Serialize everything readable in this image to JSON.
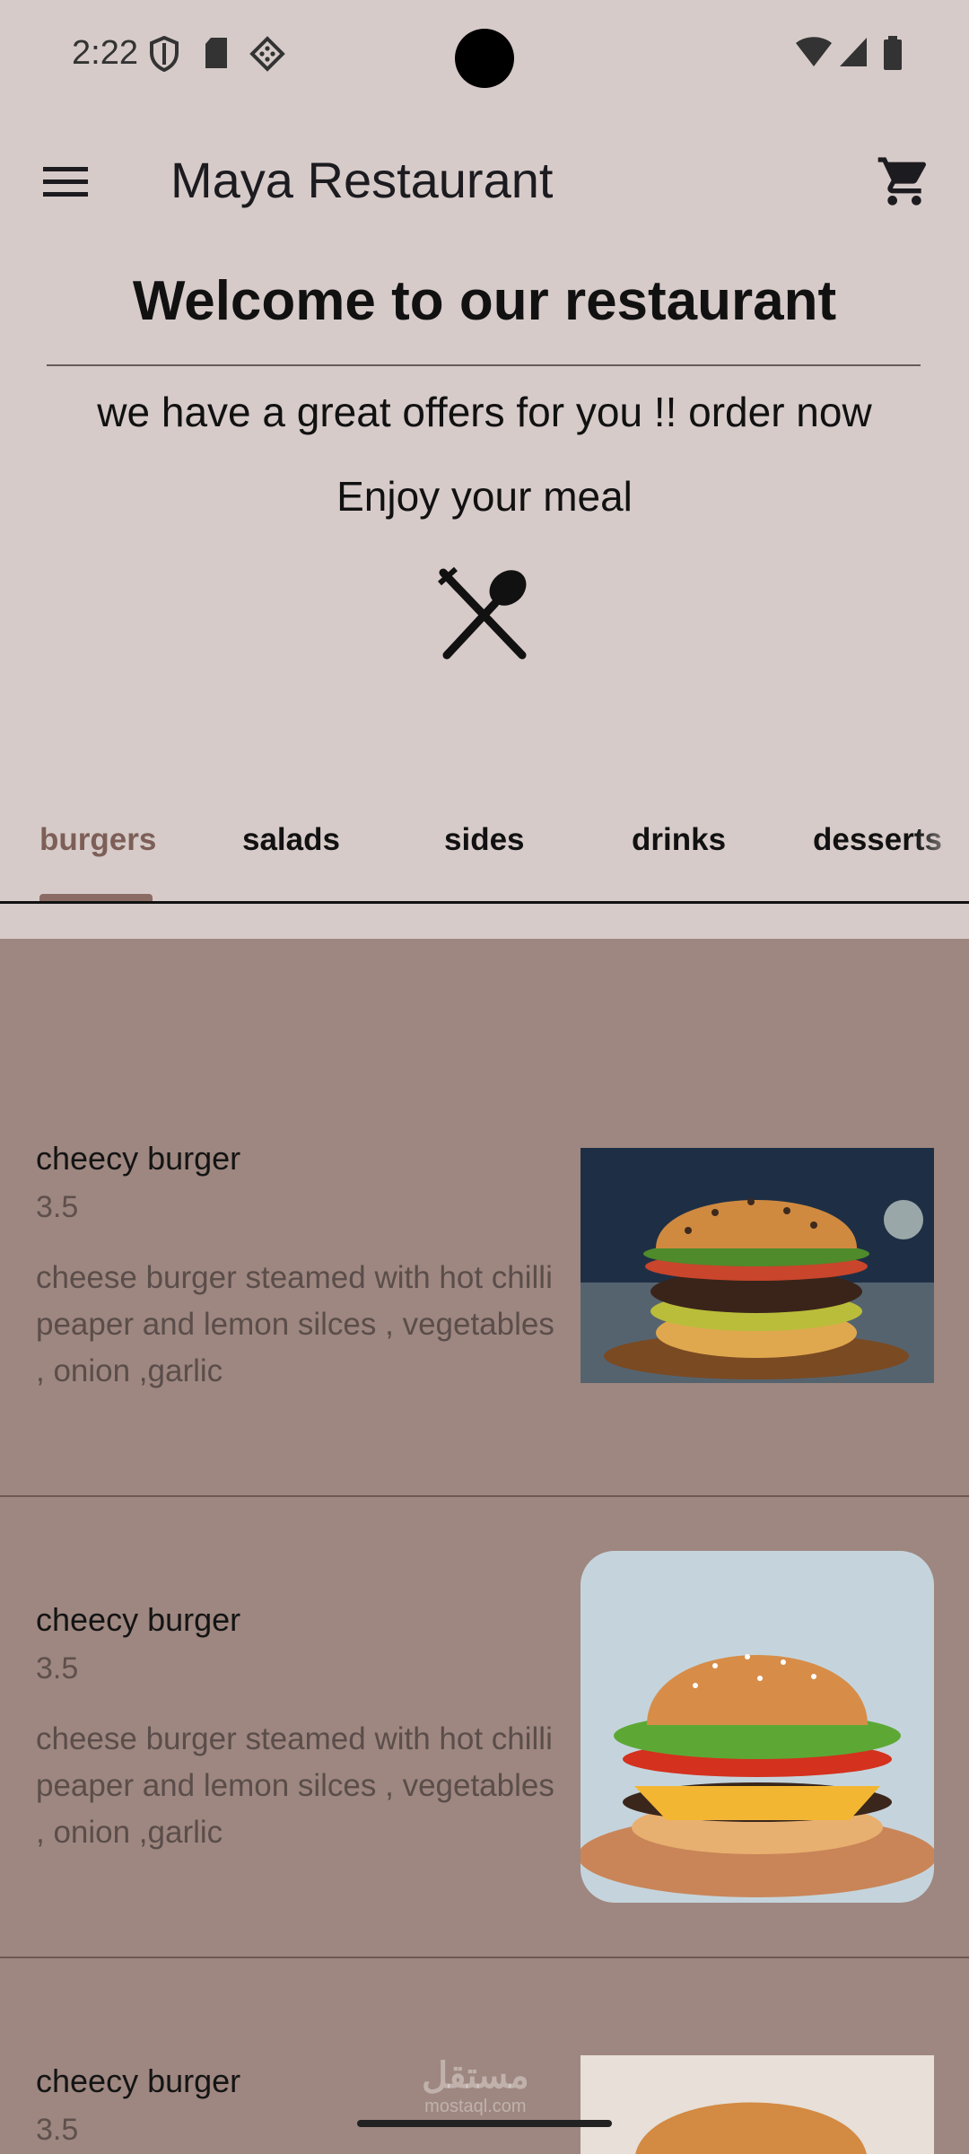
{
  "status_bar": {
    "time": "2:22",
    "icons": [
      "shield-icon",
      "sd-card-icon",
      "puzzle-icon",
      "wifi-icon",
      "signal-icon",
      "battery-icon"
    ]
  },
  "app_bar": {
    "title": "Maya Restaurant",
    "menu_icon": "menu-icon",
    "cart_icon": "cart-icon"
  },
  "hero": {
    "heading": "Welcome to our restaurant",
    "offer": "we have a great offers for you !! order now",
    "tagline": "Enjoy your meal",
    "icon": "utensils-icon"
  },
  "tabs": [
    {
      "label": "burgers",
      "active": true
    },
    {
      "label": "salads",
      "active": false
    },
    {
      "label": "sides",
      "active": false
    },
    {
      "label": "drinks",
      "active": false
    },
    {
      "label": "desserts",
      "active": false
    }
  ],
  "menu_items": [
    {
      "name": "cheecy burger",
      "price": "3.5",
      "description": "cheese burger steamed with hot chilli peaper and lemon silces , vegetables , onion ,garlic"
    },
    {
      "name": "cheecy burger",
      "price": "3.5",
      "description": "cheese burger steamed with hot chilli peaper and lemon silces , vegetables , onion ,garlic"
    },
    {
      "name": "cheecy burger",
      "price": "3.5",
      "description": ""
    }
  ],
  "watermark": {
    "arabic": "مستقل",
    "latin": "mostaql.com"
  },
  "colors": {
    "background": "#d6cbc9",
    "list_background": "#9e8780",
    "accent": "#8b6c64"
  }
}
